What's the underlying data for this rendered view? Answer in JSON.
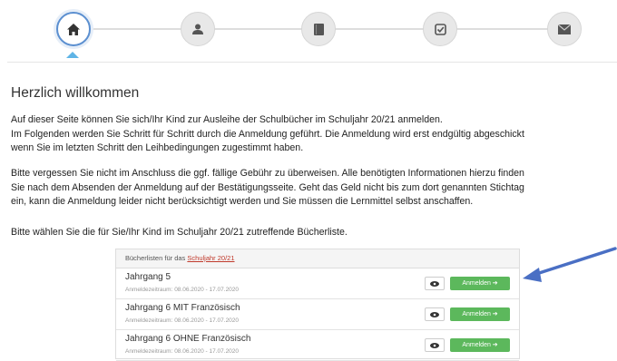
{
  "stepper": {
    "steps": [
      {
        "icon": "home-icon",
        "active": true
      },
      {
        "icon": "user-icon",
        "active": false
      },
      {
        "icon": "book-icon",
        "active": false
      },
      {
        "icon": "checkbox-icon",
        "active": false
      },
      {
        "icon": "envelope-icon",
        "active": false
      }
    ]
  },
  "content": {
    "title": "Herzlich willkommen",
    "para1": [
      "Auf dieser Seite können Sie sich/Ihr Kind zur Ausleihe der Schulbücher im Schuljahr 20/21 anmelden.",
      "Im Folgenden werden Sie Schritt für Schritt durch die Anmeldung geführt. Die Anmeldung wird erst endgültig abgeschickt",
      "wenn Sie im letzten Schritt den Leihbedingungen zugestimmt haben."
    ],
    "para2": [
      "Bitte vergessen Sie nicht im Anschluss die ggf. fällige Gebühr zu überweisen. Alle benötigten Informationen hierzu finden",
      "Sie nach dem Absenden der Anmeldung auf der Bestätigungsseite. Geht das Geld nicht bis zum dort genannten Stichtag",
      "ein, kann die Anmeldung leider nicht berücksichtigt werden und Sie müssen die Lernmittel selbst anschaffen."
    ],
    "para3": "Bitte wählen Sie die für Sie/Ihr Kind im Schuljahr 20/21 zutreffende Bücherliste."
  },
  "booklists": {
    "header_prefix": "Bücherlisten für das",
    "header_link": "Schuljahr 20/21",
    "register_label": "Anmelden ➔",
    "items": [
      {
        "name": "Jahrgang 5",
        "period": "Anmeldezeitraum: 08.06.2020 - 17.07.2020"
      },
      {
        "name": "Jahrgang 6 MIT Französisch",
        "period": "Anmeldezeitraum: 08.06.2020 - 17.07.2020"
      },
      {
        "name": "Jahrgang 6 OHNE Französisch",
        "period": "Anmeldezeitraum: 08.06.2020 - 17.07.2020"
      }
    ]
  },
  "colors": {
    "accent": "#5b8fd0",
    "register": "#5cb85c",
    "link": "#c0392b",
    "annotation_arrow": "#4a6fc4"
  }
}
